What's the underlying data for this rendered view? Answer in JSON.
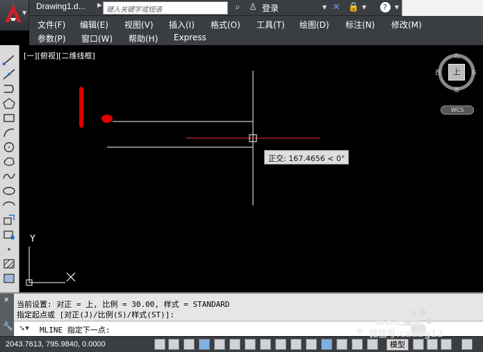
{
  "titlebar": {
    "document_title": "Drawing1.d...",
    "search_placeholder": "键入关键字或短语",
    "login_label": "登录"
  },
  "menu": {
    "row1": [
      "文件(F)",
      "编辑(E)",
      "视图(V)",
      "插入(I)",
      "格式(O)",
      "工具(T)",
      "绘图(D)",
      "标注(N)",
      "修改(M)"
    ],
    "row2": [
      "参数(P)",
      "窗口(W)",
      "帮助(H)",
      "Express"
    ]
  },
  "viewport": {
    "view_label": "[一][俯视][二维线框]",
    "tooltip": "正交: 167.4656 < 0°",
    "axis_y": "Y",
    "viewcube": {
      "north": "北",
      "south": "南",
      "east": "东",
      "west": "西",
      "top_face": "上",
      "wcs": "WCS"
    }
  },
  "command": {
    "history": [
      "当前设置: 对正 = 上, 比例 = 30.00, 样式 = STANDARD",
      "指定起点或 [对正(J)/比例(S)/样式(ST)]:"
    ],
    "prompt": "MLINE 指定下一点:"
  },
  "status": {
    "coordinates": "2043.7613, 795.9840, 0.0000",
    "model_tab": "模型"
  },
  "watermark": {
    "brand": "Bai经验",
    "author": "微信号:cadbg12"
  },
  "colors": {
    "chrome": "#3a3d41",
    "canvas": "#000000",
    "annotation_red": "#e00000"
  }
}
